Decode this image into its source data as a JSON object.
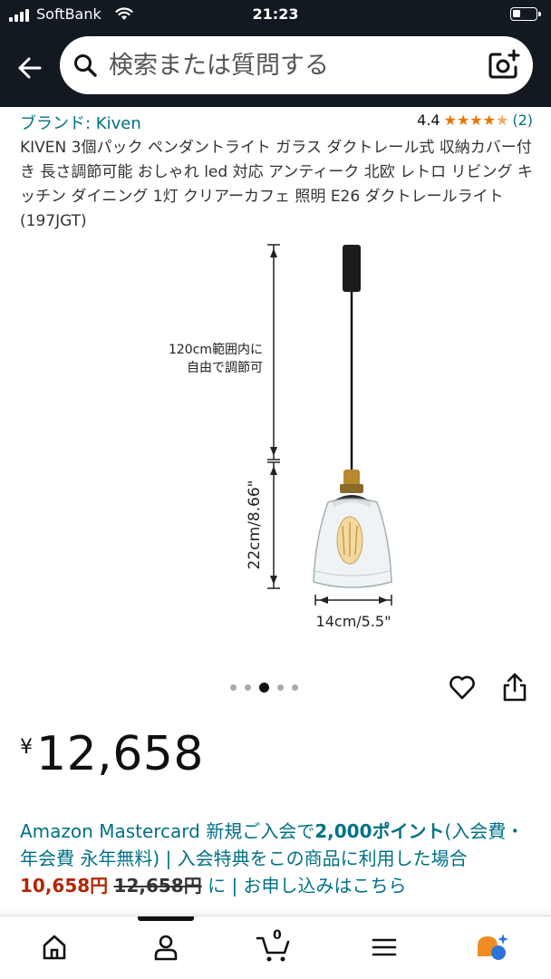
{
  "status_bar": {
    "carrier": "SoftBank",
    "time": "21:23"
  },
  "search": {
    "placeholder": "検索または質問する"
  },
  "product": {
    "brand": "ブランド: Kiven",
    "rating": "4.4",
    "rating_count": "(2)",
    "title": "KIVEN 3個パック ペンダントライト ガラス ダクトレール式 収納カバー付き 長さ調節可能 おしゃれ led 対応 アンティーク 北欧 レトロ リビング キッチン ダイニング 1灯 クリアーカフェ 照明 E26 ダクトレールライト (197JGT)",
    "image_labels": {
      "length_note_line1": "120cm範囲内に",
      "length_note_line2": "自由で調節可",
      "height": "22cm/8.66\"",
      "width": "14cm/5.5\""
    },
    "carousel": {
      "total": 5,
      "active_index": 2
    },
    "price_symbol": "¥",
    "price": "12,658"
  },
  "promo": {
    "part1": "Amazon Mastercard 新規ご入会で",
    "points": "2,000ポイント",
    "part2": "(入会費・年会費 永年無料) | 入会特典をこの商品に利用した場合",
    "discounted_price": "10,658円",
    "space": " ",
    "original_price": "12,658円",
    "part3": " に | お申し込みはこちら"
  },
  "bottom_nav": {
    "cart_count": "0",
    "items": [
      "home-icon",
      "account-icon",
      "cart-icon",
      "menu-icon",
      "rufus-icon"
    ]
  },
  "colors": {
    "header_bg": "#131921",
    "link": "#007185",
    "star": "#e77600",
    "deal_red": "#b12704"
  }
}
